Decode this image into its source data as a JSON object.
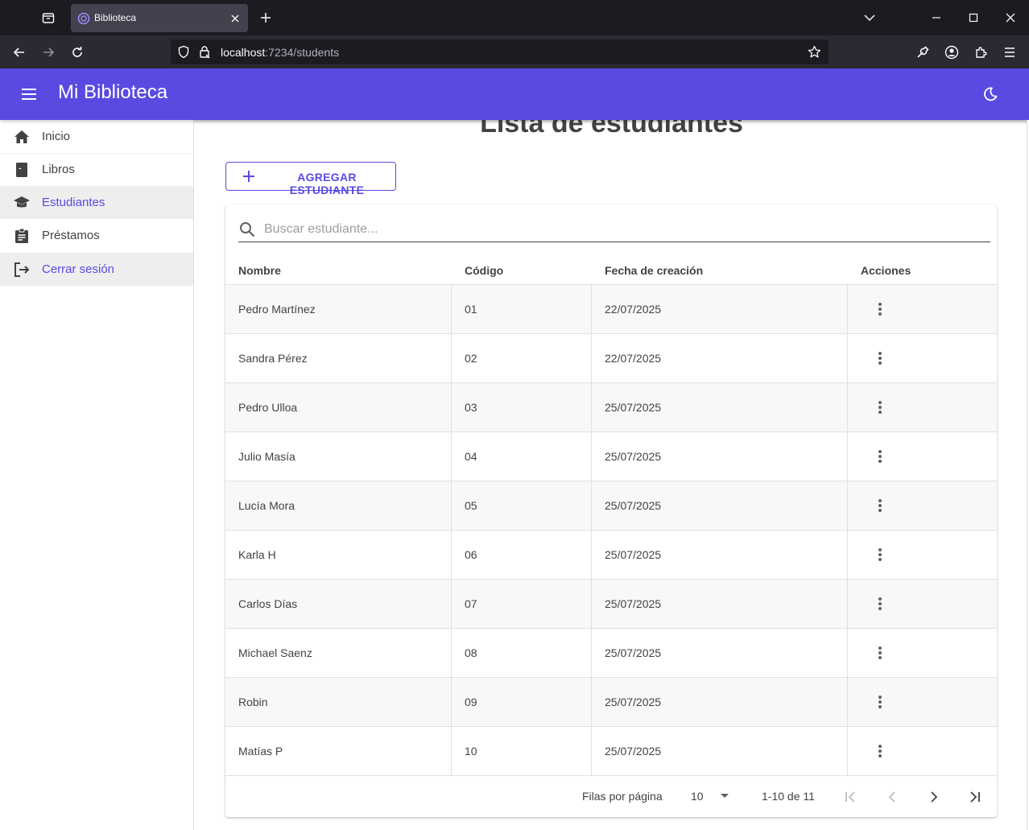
{
  "browser": {
    "tab_title": "Biblioteca",
    "url_host": "localhost",
    "url_rest": ":7234/students"
  },
  "app": {
    "title": "Mi Biblioteca"
  },
  "sidebar": {
    "items": [
      {
        "label": "Inicio",
        "icon": "home-icon"
      },
      {
        "label": "Libros",
        "icon": "book-icon"
      },
      {
        "label": "Estudiantes",
        "icon": "graduation-cap-icon",
        "active": true
      },
      {
        "label": "Préstamos",
        "icon": "clipboard-icon"
      },
      {
        "label": "Cerrar sesión",
        "icon": "logout-icon"
      }
    ]
  },
  "main": {
    "title": "Lista de estudiantes",
    "add_button": "AGREGAR ESTUDIANTE",
    "search_placeholder": "Buscar estudiante...",
    "columns": [
      "Nombre",
      "Código",
      "Fecha de creación",
      "Acciones"
    ],
    "rows": [
      {
        "name": "Pedro Martínez",
        "code": "01",
        "date": "22/07/2025"
      },
      {
        "name": "Sandra Pérez",
        "code": "02",
        "date": "22/07/2025"
      },
      {
        "name": "Pedro Ulloa",
        "code": "03",
        "date": "25/07/2025"
      },
      {
        "name": "Julio Masía",
        "code": "04",
        "date": "25/07/2025"
      },
      {
        "name": "Lucía Mora",
        "code": "05",
        "date": "25/07/2025"
      },
      {
        "name": "Karla H",
        "code": "06",
        "date": "25/07/2025"
      },
      {
        "name": "Carlos Días",
        "code": "07",
        "date": "25/07/2025"
      },
      {
        "name": "Michael Saenz",
        "code": "08",
        "date": "25/07/2025"
      },
      {
        "name": "Robin",
        "code": "09",
        "date": "25/07/2025"
      },
      {
        "name": "Matías P",
        "code": "10",
        "date": "25/07/2025"
      }
    ],
    "pagination": {
      "rows_per_page_label": "Filas por página",
      "rows_per_page": "10",
      "range": "1-10 de 11"
    }
  },
  "colors": {
    "accent": "#594ae2"
  }
}
